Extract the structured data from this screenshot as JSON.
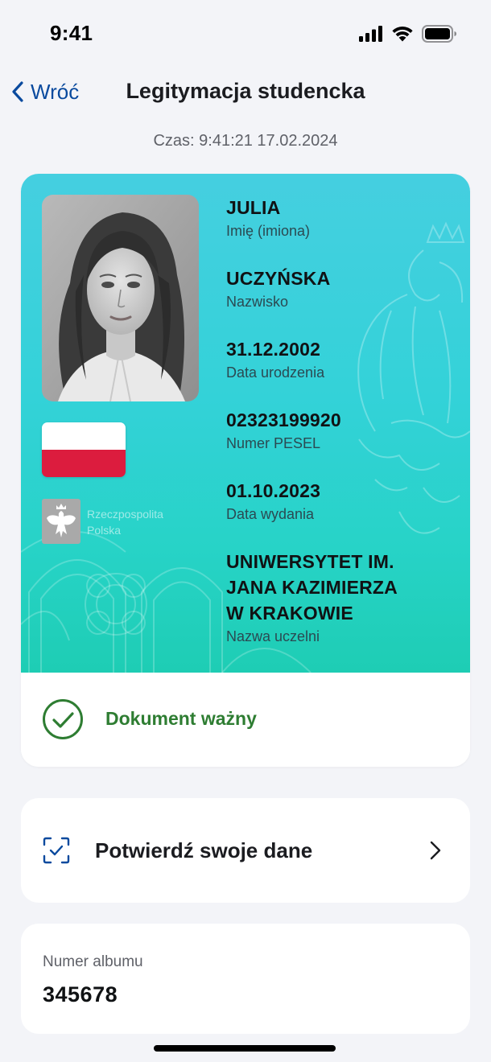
{
  "status_bar": {
    "time": "9:41"
  },
  "nav": {
    "back_label": "Wróć",
    "title": "Legitymacja studencka"
  },
  "timestamp": "Czas: 9:41:21 17.02.2024",
  "card": {
    "emblem_text_line1": "Rzeczpospolita",
    "emblem_text_line2": "Polska",
    "fields": [
      {
        "value": "JULIA",
        "label": "Imię (imiona)"
      },
      {
        "value": "UCZYŃSKA",
        "label": "Nazwisko"
      },
      {
        "value": "31.12.2002",
        "label": "Data urodzenia"
      },
      {
        "value": "02323199920",
        "label": "Numer PESEL"
      },
      {
        "value": "01.10.2023",
        "label": "Data wydania"
      }
    ],
    "university": {
      "line1": "UNIWERSYTET IM.",
      "line2": "JANA KAZIMIERZA",
      "line3": "W KRAKOWIE",
      "label": "Nazwa uczelni"
    },
    "status": "Dokument ważny",
    "colors": {
      "valid": "#2e7d32",
      "flag_red": "#dc1c3e",
      "card_top": "#45cfe0",
      "card_bottom": "#1ecdb4"
    }
  },
  "confirm": {
    "label": "Potwierdź swoje dane",
    "icon": "scan-check-icon"
  },
  "album": {
    "label": "Numer albumu",
    "value": "345678"
  },
  "accent_color": "#0a4a9e"
}
